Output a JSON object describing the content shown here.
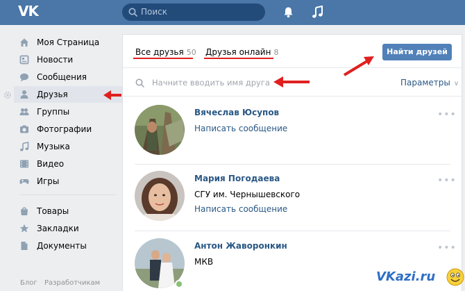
{
  "topbar": {
    "logo": "ВК",
    "search_placeholder": "Поиск"
  },
  "sidebar": {
    "items": [
      {
        "label": "Моя Страница",
        "icon": "home-icon"
      },
      {
        "label": "Новости",
        "icon": "news-icon"
      },
      {
        "label": "Сообщения",
        "icon": "messages-icon"
      },
      {
        "label": "Друзья",
        "icon": "friends-icon",
        "active": true
      },
      {
        "label": "Группы",
        "icon": "groups-icon"
      },
      {
        "label": "Фотографии",
        "icon": "photos-icon"
      },
      {
        "label": "Музыка",
        "icon": "music-icon"
      },
      {
        "label": "Видео",
        "icon": "video-icon"
      },
      {
        "label": "Игры",
        "icon": "games-icon"
      },
      {
        "label": "Товары",
        "icon": "goods-icon"
      },
      {
        "label": "Закладки",
        "icon": "bookmarks-icon"
      },
      {
        "label": "Документы",
        "icon": "documents-icon"
      }
    ],
    "footer": [
      "Блог",
      "Разработчикам"
    ]
  },
  "main": {
    "tabs": [
      {
        "label": "Все друзья",
        "count": "50"
      },
      {
        "label": "Друзья онлайн",
        "count": "8"
      }
    ],
    "find_button": "Найти друзей",
    "friend_search_placeholder": "Начните вводить имя друга",
    "params_label": "Параметры",
    "friends": [
      {
        "name": "Вячеслав Юсупов",
        "lines": [],
        "action": "Написать сообщение",
        "online": false
      },
      {
        "name": "Мария Погодаева",
        "lines": [
          "СГУ им. Чернышевского"
        ],
        "action": "Написать сообщение",
        "online": false
      },
      {
        "name": "Антон Жаворонкин",
        "lines": [
          "МКВ"
        ],
        "action": "",
        "online": true
      }
    ]
  },
  "watermark": "VKazi.ru",
  "colors": {
    "header": "#4a76a8",
    "accent": "#5181b8",
    "link": "#2a5885",
    "annotation": "#e0201f"
  }
}
